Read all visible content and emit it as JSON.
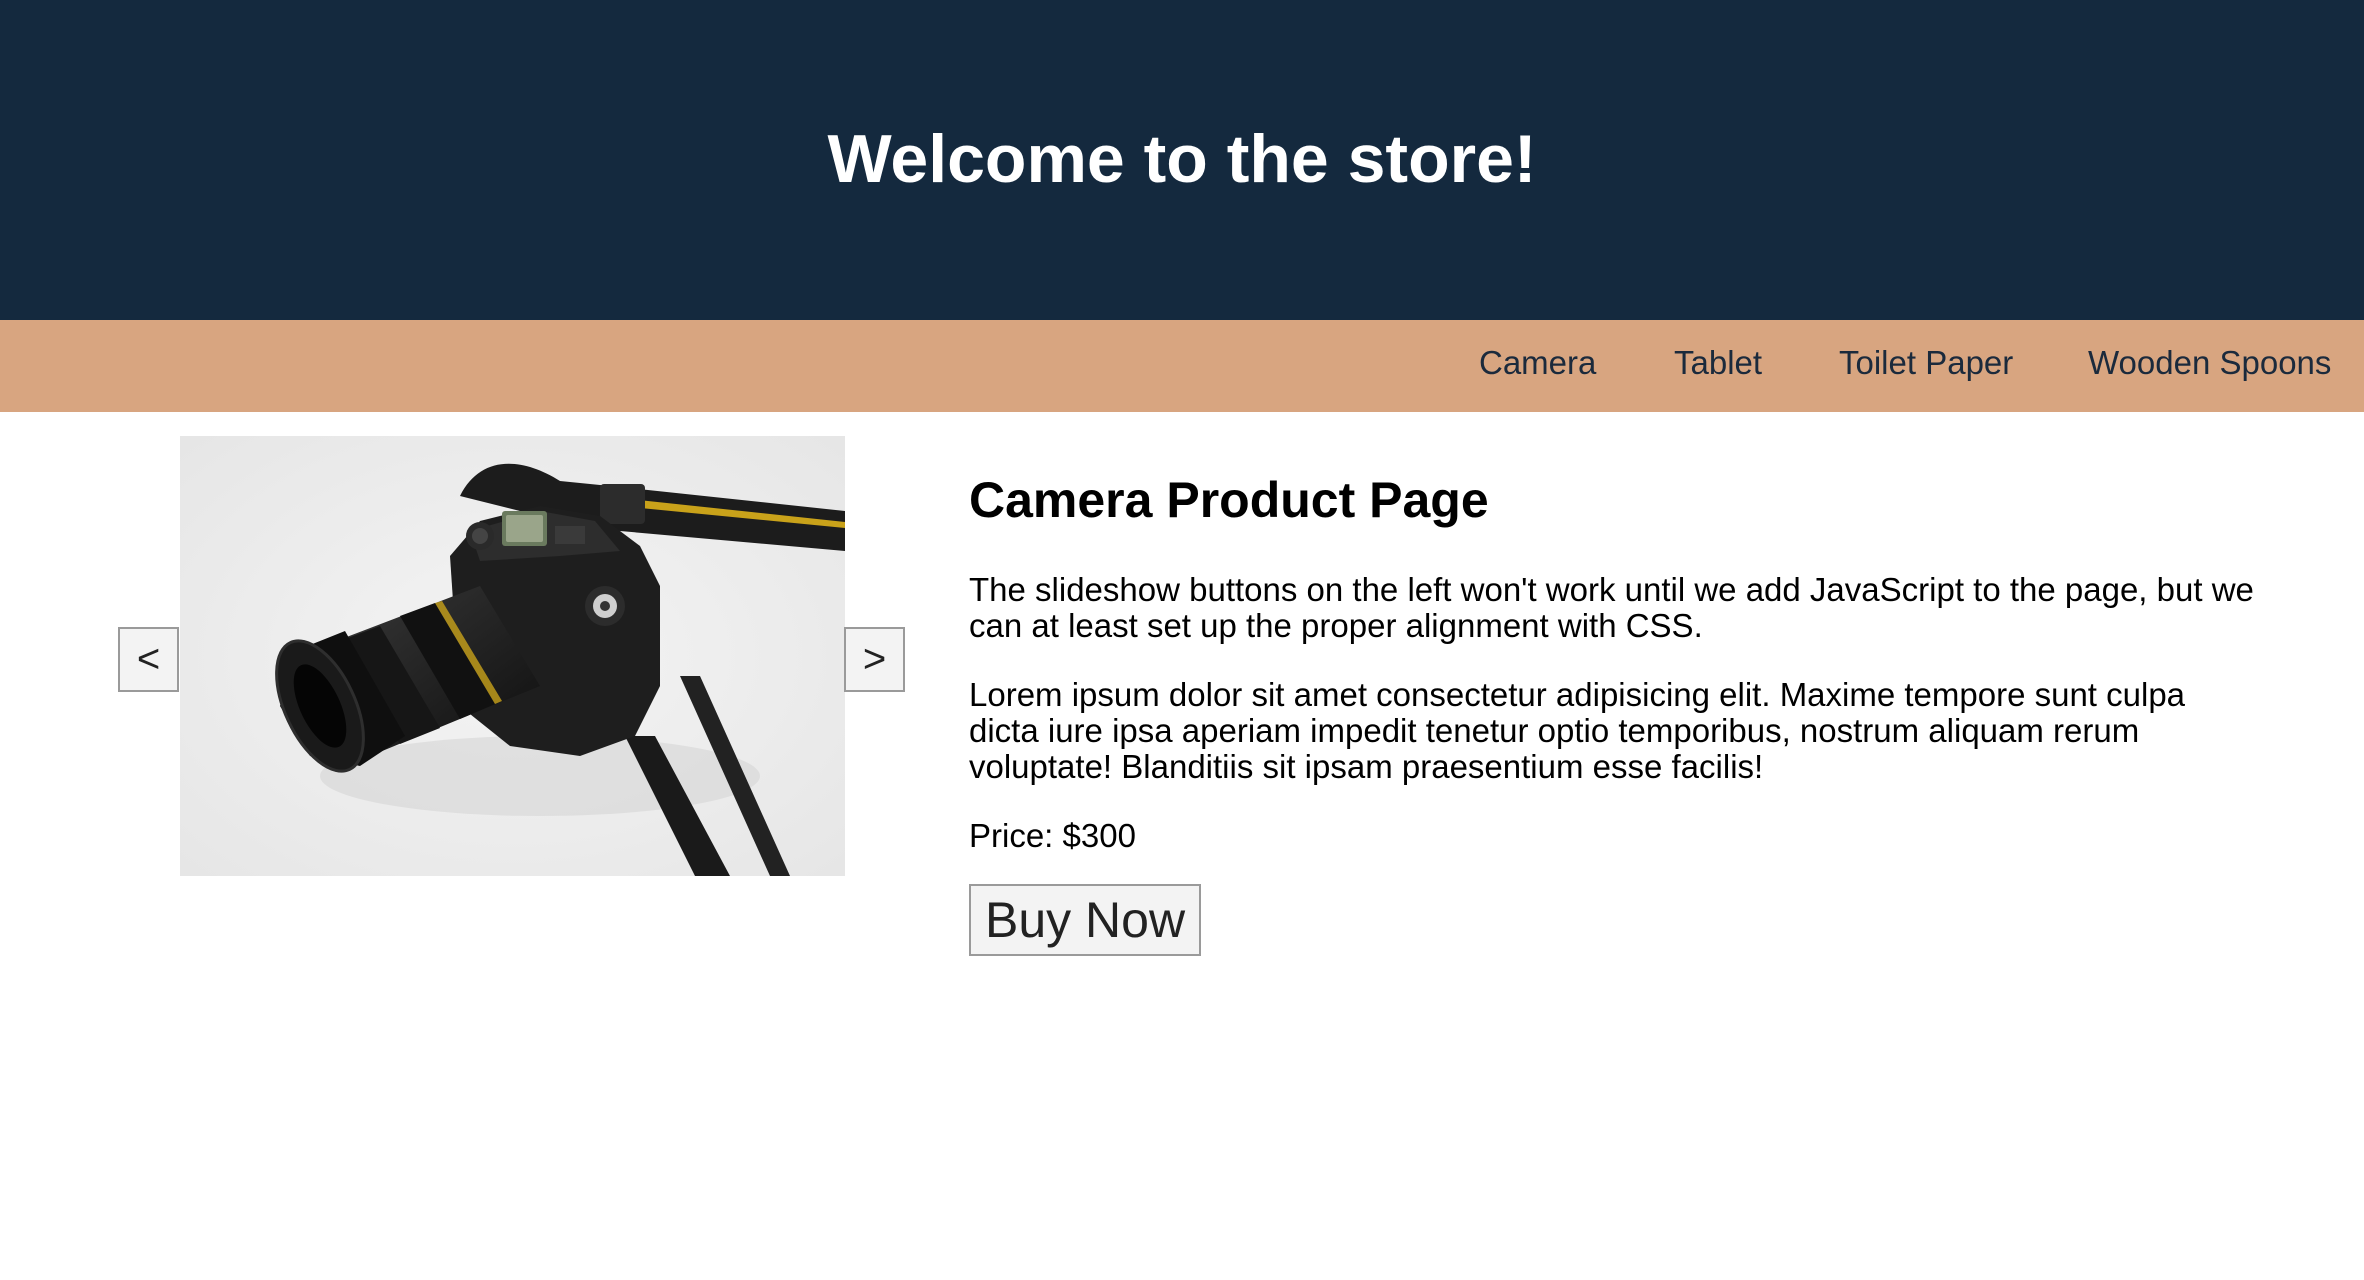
{
  "header": {
    "title": "Welcome to the store!"
  },
  "nav": {
    "items": [
      {
        "label": "Camera"
      },
      {
        "label": "Tablet"
      },
      {
        "label": "Toilet Paper"
      },
      {
        "label": "Wooden Spoons"
      }
    ]
  },
  "slideshow": {
    "prev_label": "<",
    "next_label": ">",
    "image_subject": "camera-photo"
  },
  "product": {
    "title": "Camera Product Page",
    "paragraph1": "The slideshow buttons on the left won't work until we add JavaScript to the page, but we can at least set up the proper alignment with CSS.",
    "paragraph2": "Lorem ipsum dolor sit amet consectetur adipisicing elit. Maxime tempore sunt culpa dicta iure ipsa aperiam impedit tenetur optio temporibus, nostrum aliquam rerum voluptate! Blanditiis sit ipsam praesentium esse facilis!",
    "price": "Price: $300",
    "buy_label": "Buy Now"
  },
  "colors": {
    "header_bg": "#14293e",
    "nav_bg": "#d8a580",
    "nav_text": "#1b2a3c"
  }
}
